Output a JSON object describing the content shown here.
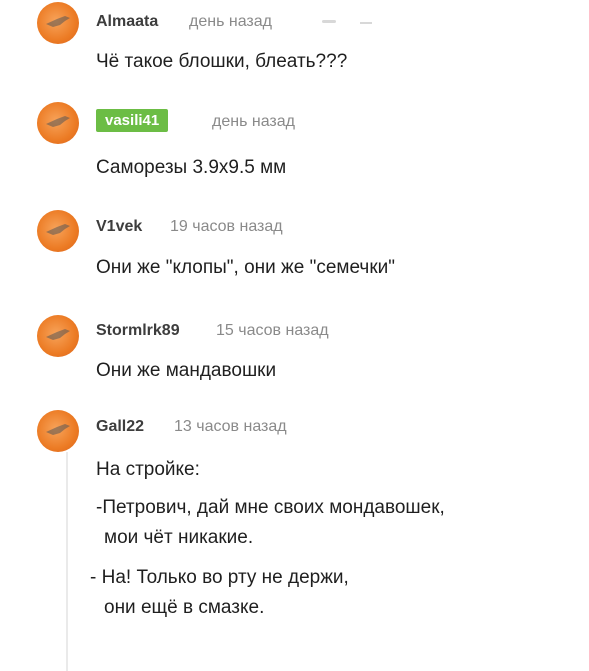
{
  "comments": [
    {
      "author": "Almaata",
      "time": "день назад",
      "text": "Чё такое блошки, блеать???"
    },
    {
      "author": "vasili41",
      "time": "день назад",
      "text": "Саморезы 3.9х9.5 мм"
    },
    {
      "author": "V1vek",
      "time": "19 часов назад",
      "text": "Они же \"клопы\", они же \"семечки\""
    },
    {
      "author": "Stormlrk89",
      "time": "15 часов назад",
      "text": "Они же мандавошки"
    },
    {
      "author": "Gall22",
      "time": "13 часов назад",
      "lines": [
        "На стройке:",
        "-Петрович, дай мне своих мондавошек,",
        "мои чёт никакие.",
        "- На! Только во рту не держи,",
        "они ещё в смазке."
      ]
    }
  ],
  "colors": {
    "avatar": "#ec7b24",
    "badge": "#6cbd45"
  }
}
